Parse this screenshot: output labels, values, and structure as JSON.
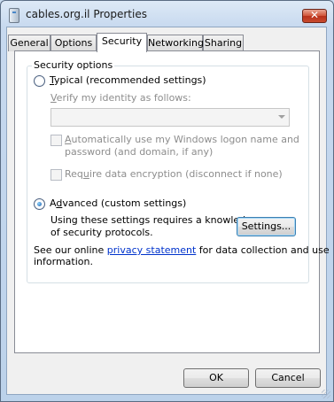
{
  "window": {
    "title": "cables.org.il Properties",
    "close_symbol": "✕"
  },
  "tabs": [
    {
      "label": "General",
      "selected": false
    },
    {
      "label": "Options",
      "selected": false
    },
    {
      "label": "Security",
      "selected": true
    },
    {
      "label": "Networking",
      "selected": false
    },
    {
      "label": "Sharing",
      "selected": false
    }
  ],
  "security": {
    "group_label": "Security options",
    "typical": {
      "label_accel": "T",
      "label_rest": "ypical (recommended settings)",
      "checked": false
    },
    "verify": {
      "label_accel": "V",
      "label_rest": "erify my identity as follows:",
      "selected_value": ""
    },
    "auto_logon": {
      "accel": "A",
      "line1_rest": "utomatically use my Windows logon name and",
      "line2": "password (and domain, if any)",
      "checked": false
    },
    "encryption": {
      "pre": "Req",
      "accel": "u",
      "post": "ire data encryption (disconnect if none)",
      "checked": false
    },
    "advanced": {
      "pre": "A",
      "accel": "d",
      "post": "vanced (custom settings)",
      "checked": true
    },
    "advanced_desc_line1": "Using these settings requires a knowledge",
    "advanced_desc_line2": "of security protocols.",
    "settings_button": "Settings...",
    "privacy_pre": "See our online",
    "privacy_link": "privacy statement",
    "privacy_post": "for data collection and use",
    "privacy_line2": "information."
  },
  "footer": {
    "ok_label": "OK",
    "cancel_label": "Cancel"
  },
  "colors": {
    "link": "#0033cc",
    "close_button": "#c94b2f",
    "disabled_text": "#8d8d8d"
  }
}
